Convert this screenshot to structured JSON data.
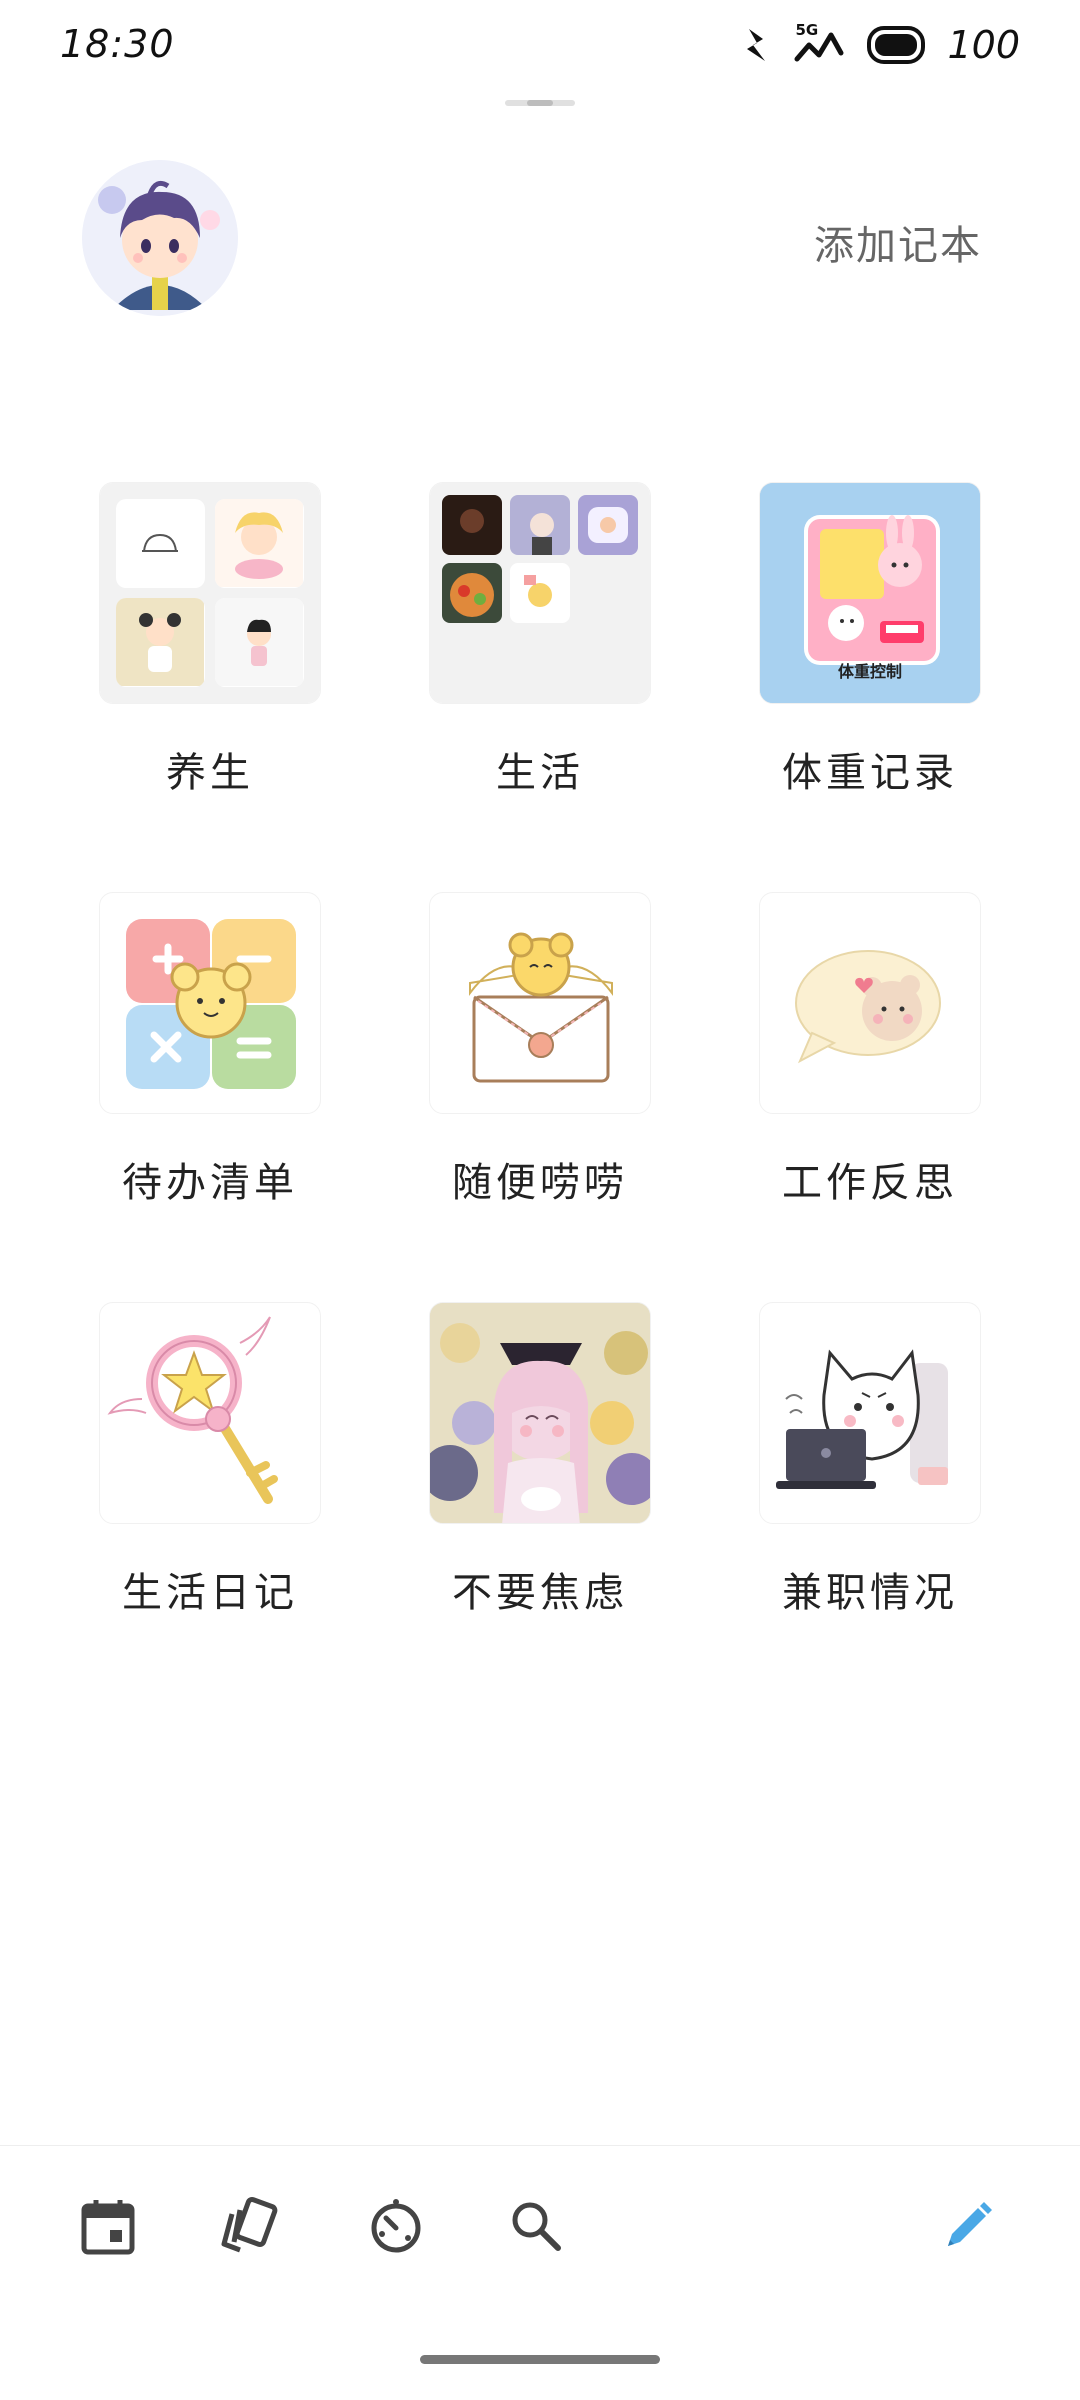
{
  "status_bar": {
    "time": "18:30",
    "network": "5G",
    "battery": "100"
  },
  "header": {
    "add_notebook_label": "添加记本"
  },
  "notebooks": [
    {
      "label": "养生"
    },
    {
      "label": "生活"
    },
    {
      "label": "体重记录",
      "cover_text": "体重控制"
    },
    {
      "label": "待办清单"
    },
    {
      "label": "随便唠唠"
    },
    {
      "label": "工作反思"
    },
    {
      "label": "生活日记"
    },
    {
      "label": "不要焦虑"
    },
    {
      "label": "兼职情况"
    }
  ],
  "bottom_nav": {
    "items": [
      "calendar-icon",
      "cards-icon",
      "timer-icon",
      "search-icon",
      "pencil-icon"
    ],
    "accent_color": "#4aa8e6"
  }
}
